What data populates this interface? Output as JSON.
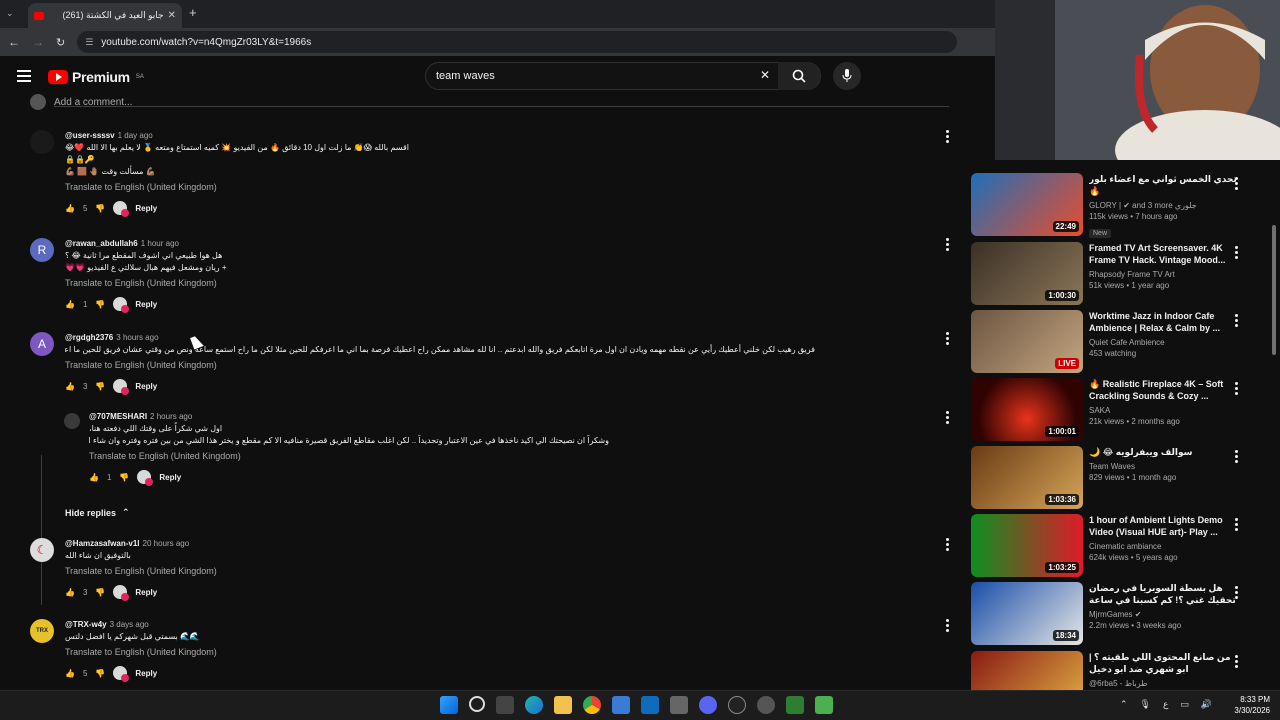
{
  "browser": {
    "tab_title": "جابو العيد في الكشتة (261)",
    "new_tab": "+",
    "url": "youtube.com/watch?v=n4QmgZr03LY&t=1966s"
  },
  "yt": {
    "brand": "Premium",
    "region": "SA",
    "search_value": "team waves"
  },
  "add_comment": "Add a comment...",
  "translate_label": "Translate to English (United Kingdom)",
  "reply_label": "Reply",
  "hide_replies": "Hide replies",
  "comments": [
    {
      "user": "@user-ssssv",
      "time": "1 day ago",
      "lines": [
        "اقسم بالله 😱👏 ما زلت اول 10 دقائق 🔥 من الفيديو 💥 كميه استمتاع ومتعه 🥇 لا يعلم بها الا الله ❤️😂",
        "🔒🔒🔑",
        "💪🏽 مسألت وقت 🤚🏽 🟫 💪🏽"
      ],
      "likes": "5"
    },
    {
      "user": "@rawan_abdullah6",
      "time": "1 hour ago",
      "lines": [
        "هل هوا طبيعي اني اشوف المقطع مرا ثانية 😂 ؟",
        "+ ريان ومشعل فيهم هبال سلالتي ع الفيديو 💗💗"
      ],
      "likes": "1"
    },
    {
      "user": "@rgdgh2376",
      "time": "3 hours ago",
      "lines": [
        "فريق رهيب لكن خلني أعطيك رأيي عن نقطه مهمه ويادن ان اول مرة اتابعكم فريق والله ابدعتم .. انا لله مشاهد ممكن راح اعطيك فرصة بما اني ما اعرفكم للحين مثلا لكن ما راح استمع ساعه ونص من وقتي عشان فريق للحين ما اعرفه .. بما انكم مشاهد اجهاد مستقبلكم اكثر .. ومااعرف فيهم احد صريحة ما عرفتهم"
      ],
      "likes": "3"
    },
    {
      "user": "@Hamzasafwan-v1l",
      "time": "20 hours ago",
      "lines": [
        "بالتوفيق ان شاء الله"
      ],
      "likes": "3"
    },
    {
      "user": "@TRX-w4y",
      "time": "3 days ago",
      "lines": [
        "🌊🌊 بسمتي قبل شهركم يا افضل دلتس"
      ],
      "likes": "5"
    }
  ],
  "reply": {
    "user": "@707MESHARI",
    "time": "2 hours ago",
    "lines": [
      "اول شي شكراً على وقتك اللي دفعته هنا،",
      "وشكراً ان نصيحتك الي اكيد ناخذها في عين الاعتبار وتحديداً .. لكن اغلب مقاطع الفريق قصيرة منافيه الا كم مقطع و يختر هذا الشي من بين فتره وفتره وان شاء الله نعدكم نعم شكراً ❤️"
    ],
    "likes": "1"
  },
  "sidebar": [
    {
      "title": "تحدي الخمس ثواني مع اعضاء بلور 🔥",
      "channel": "GLORY | ✔ and 3 more جلوري",
      "meta": "115k views • 7 hours ago",
      "badge": "New",
      "duration": "22:49",
      "colors": [
        "#1e6fb9",
        "#e94d2b"
      ]
    },
    {
      "title": "Framed TV Art Screensaver. 4K Frame TV Hack. Vintage Mood...",
      "channel": "Rhapsody Frame TV Art",
      "meta": "51k views • 1 year ago",
      "duration": "1:00:30",
      "colors": [
        "#3b3026",
        "#8a7757"
      ]
    },
    {
      "title": "Worktime Jazz in Indoor Cafe Ambience | Relax & Calm by ...",
      "channel": "Quiet Cafe Ambience",
      "meta": "453 watching",
      "duration": "LIVE",
      "live": true,
      "colors": [
        "#6b5642",
        "#c4a57f"
      ]
    },
    {
      "title": "🔥 Realistic Fireplace 4K – Soft Crackling Sounds & Cozy ...",
      "channel": "SAKA",
      "meta": "21k views • 2 months ago",
      "duration": "1:00:01",
      "colors": [
        "#300303",
        "#e8341a"
      ]
    },
    {
      "title": "سوالف ويبفرلويه 😂 🌙",
      "channel": "Team Waves",
      "meta": "829 views • 1 month ago",
      "duration": "1:03:36",
      "colors": [
        "#6a3b15",
        "#d5a559"
      ]
    },
    {
      "title": "1 hour of Ambient Lights Demo Video (Visual HUE art)- Play ...",
      "channel": "Cinematic ambiance",
      "meta": "624k views • 5 years ago",
      "duration": "1:03:25",
      "colors": [
        "#0d8f1f",
        "#e01a2a"
      ]
    },
    {
      "title": "هل بسطة السوبريا في رمضان تحقيك غني ؟! كم كسبنا في ساعة 🔥 !!",
      "channel": "MjrmGames ✔",
      "meta": "2.2m views • 3 weeks ago",
      "duration": "18:34",
      "colors": [
        "#1a4ea8",
        "#e6e6e6"
      ]
    },
    {
      "title": "من صانع المحتوى اللي طقيته ؟ | ابو شهري ضد ابو دخيل",
      "channel": "@6rba5 - طرباط",
      "meta": "",
      "duration": "",
      "colors": [
        "#8a1a14",
        "#e2b145"
      ]
    }
  ],
  "clock": {
    "time": "8:33 PM",
    "date": "3/30/2026"
  },
  "tray": {
    "lang": "ع"
  },
  "colors": {
    "bg": "#0f0f0f",
    "yt_red": "#ff0000",
    "muted": "#aaaaaa"
  }
}
